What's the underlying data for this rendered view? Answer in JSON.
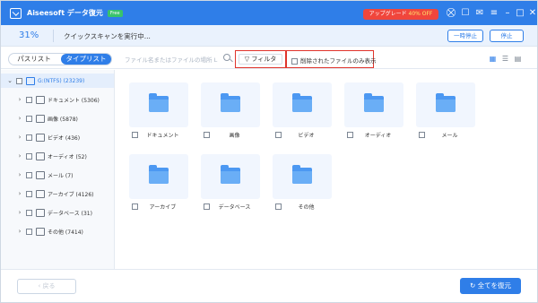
{
  "titlebar": {
    "app_title": "Aiseesoft データ復元",
    "badge": "Free",
    "upgrade_prefix": "アップグレード ",
    "upgrade_pct": "40% OFF",
    "icons": [
      "cart-icon",
      "chat-icon",
      "feedback-icon",
      "menu-icon",
      "minimize-icon",
      "maximize-icon",
      "close-icon"
    ]
  },
  "status": {
    "progress_percent": "31%",
    "message": "クイックスキャンを実行中...",
    "pause_label": "一時停止",
    "stop_label": "停止"
  },
  "toolbar": {
    "path_list": "パスリスト",
    "type_list": "タイプリスト",
    "search_placeholder": "ファイル名またはファイルの場所 L",
    "filter_label": "フィルタ",
    "deleted_only_label": "削除されたファイルのみ表示"
  },
  "tree": {
    "root": {
      "label": "G:(NTFS) (23239)"
    },
    "items": [
      {
        "label": "ドキュメント (5306)",
        "icon": "document-icon"
      },
      {
        "label": "画像 (5878)",
        "icon": "image-icon"
      },
      {
        "label": "ビデオ (436)",
        "icon": "video-icon"
      },
      {
        "label": "オーディオ (52)",
        "icon": "audio-icon"
      },
      {
        "label": "メール (7)",
        "icon": "mail-icon"
      },
      {
        "label": "アーカイブ (4126)",
        "icon": "archive-icon"
      },
      {
        "label": "データベース (31)",
        "icon": "database-icon"
      },
      {
        "label": "その他 (7414)",
        "icon": "folder-icon"
      }
    ]
  },
  "grid": {
    "cards": [
      {
        "label": "ドキュメント"
      },
      {
        "label": "画像"
      },
      {
        "label": "ビデオ"
      },
      {
        "label": "オーディオ"
      },
      {
        "label": "メール"
      },
      {
        "label": "アーカイブ"
      },
      {
        "label": "データベース"
      },
      {
        "label": "その他"
      }
    ]
  },
  "footer": {
    "back_label": "戻る",
    "recover_label": "全てを復元"
  },
  "colors": {
    "accent": "#2f7ee8",
    "upgrade": "#f0463c",
    "highlight_border": "#e0342b"
  }
}
